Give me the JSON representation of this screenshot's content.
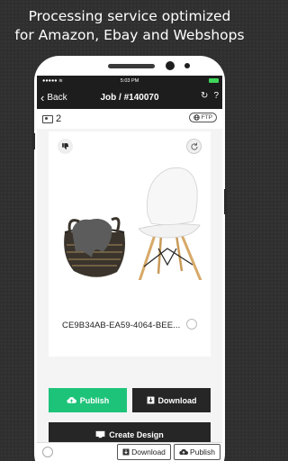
{
  "headline": {
    "line1": "Processing service optimized",
    "line2": "for Amazon, Ebay and Webshops"
  },
  "statusbar": {
    "carrier": "●●●●● ≋",
    "time": "5:03 PM"
  },
  "navbar": {
    "back_label": "Back",
    "title": "Job / #140070",
    "refresh_icon": "↻",
    "help_icon": "?"
  },
  "job": {
    "image_count": "2",
    "ftp_label": "FTP",
    "job_identifier": "CE9B34AB-EA59-4064-BEE..."
  },
  "actions": {
    "publish_label": "Publish",
    "download_label": "Download",
    "create_design_label": "Create Design"
  },
  "bottom_bar": {
    "download_label": "Download",
    "publish_label": "Publish"
  },
  "colors": {
    "publish_green": "#1ec37a",
    "dark_button": "#262626",
    "navbar": "#1d1d1d",
    "battery": "#3ed65c"
  },
  "icons": [
    "back-chevron-icon",
    "refresh-icon",
    "help-icon",
    "images-icon",
    "ftp-icon",
    "thumbs-down-icon",
    "rotate-icon",
    "cloud-upload-icon",
    "download-icon",
    "monitor-icon"
  ]
}
